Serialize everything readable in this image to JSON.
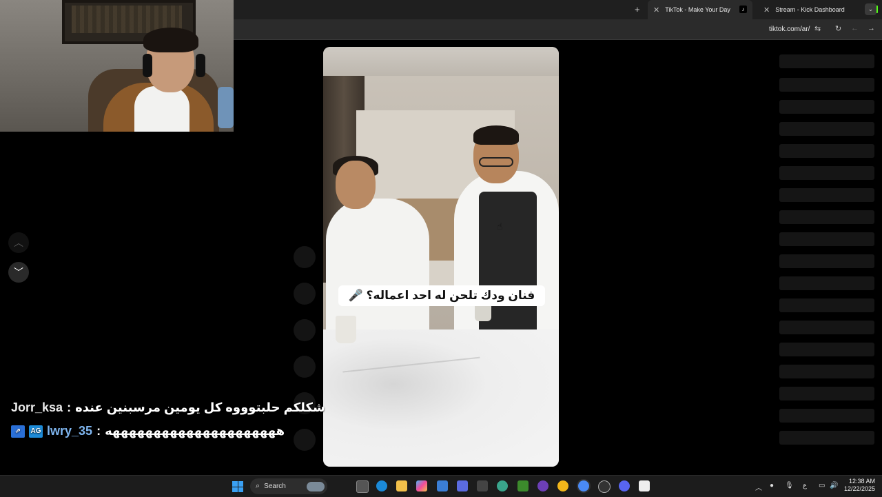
{
  "browser": {
    "tabs": [
      {
        "label": "TikTok - Make Your Day",
        "active": true,
        "icon": "tiktok-icon"
      },
      {
        "label": "Stream - Kick Dashboard",
        "active": false,
        "icon": "kick-icon"
      }
    ],
    "new_tab_symbol": "+",
    "close_symbol": "✕",
    "url": "tiktok.com/ar/",
    "toolbar_icons": [
      "site-settings-icon",
      "reload-icon",
      "back-icon",
      "forward-icon"
    ]
  },
  "video": {
    "caption": "فنان ودك تلحن له احد اعماله؟ 🎤"
  },
  "chat": [
    {
      "user": "Jorr_ksa",
      "separator": ":",
      "message": "شكلكم حلبتوووه كل يومين مرسبنين عنده"
    },
    {
      "user": "lwry_35",
      "separator": ":",
      "message": "هههههههههههههههههههههه",
      "badges": [
        "AG"
      ]
    }
  ],
  "taskbar": {
    "search_label": "Search",
    "time": "12:38 AM",
    "date": "12/22/2025",
    "language": "ع"
  }
}
